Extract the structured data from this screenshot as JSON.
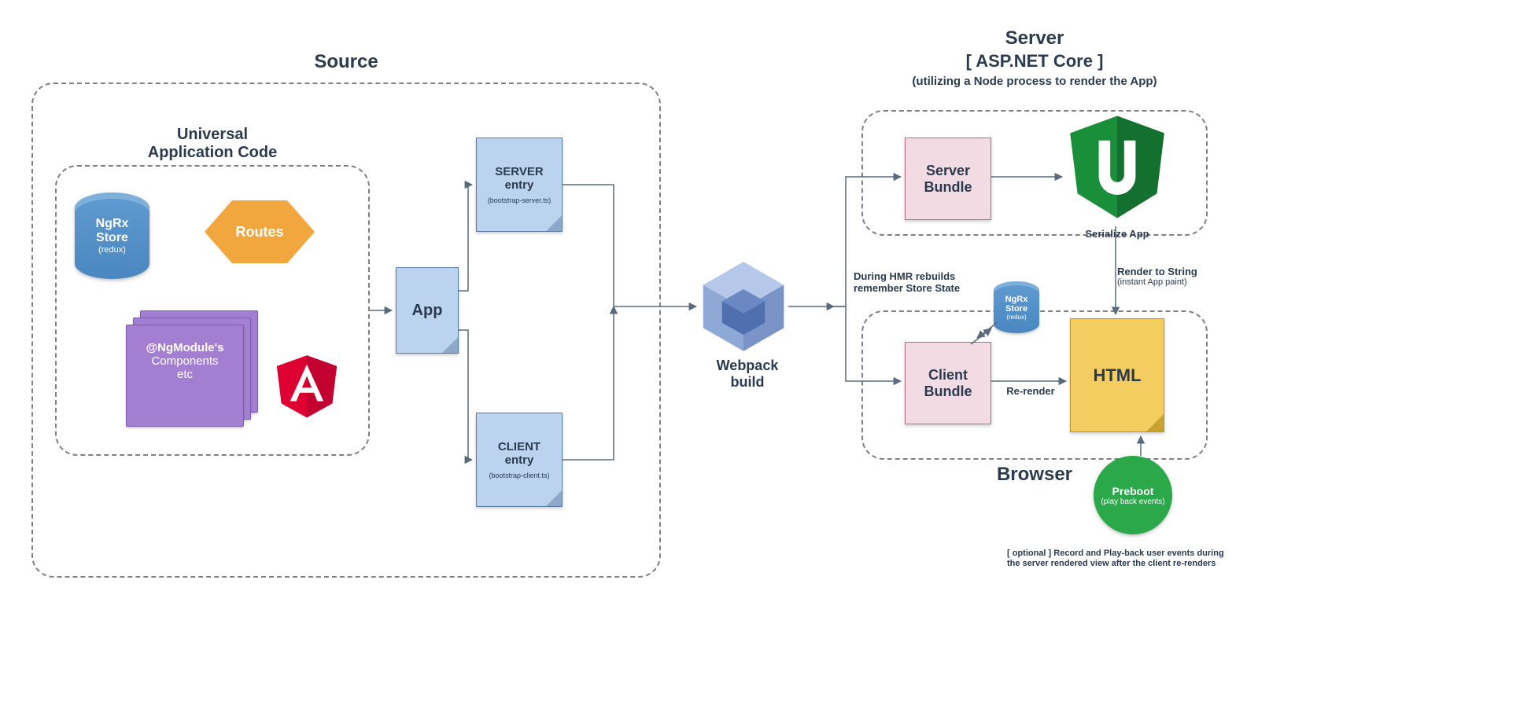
{
  "source": {
    "title": "Source",
    "uac_title_l1": "Universal",
    "uac_title_l2": "Application Code",
    "ngrx": {
      "l1": "NgRx",
      "l2": "Store",
      "sub": "(redux)"
    },
    "routes": "Routes",
    "ngmodule": {
      "l1": "@NgModule's",
      "l2": "Components",
      "l3": "etc"
    },
    "app": "App",
    "server_entry": {
      "l1": "SERVER",
      "l2": "entry",
      "file": "(bootstrap-server.ts)"
    },
    "client_entry": {
      "l1": "CLIENT",
      "l2": "entry",
      "file": "(bootstrap-client.ts)"
    }
  },
  "webpack": {
    "label_l1": "Webpack",
    "label_l2": "build"
  },
  "server": {
    "title": "Server",
    "subtitle": "[ ASP.NET Core ]",
    "note": "(utilizing a Node process to render the App)",
    "bundle": "Server Bundle",
    "serialize": "Serialize App",
    "render_l1": "Render to String",
    "render_l2": "(instant App paint)"
  },
  "browser": {
    "title": "Browser",
    "bundle": "Client Bundle",
    "html": "HTML",
    "rerender": "Re-render",
    "hmr_l1": "During HMR rebuilds",
    "hmr_l2": "remember Store State",
    "ngrx_small": {
      "l1": "NgRx",
      "l2": "Store",
      "sub": "(redux)"
    },
    "preboot": {
      "label": "Preboot",
      "sub": "(play back events)"
    },
    "optional": "[ optional ] Record and Play-back user events during the server rendered view after the client re-renders"
  }
}
